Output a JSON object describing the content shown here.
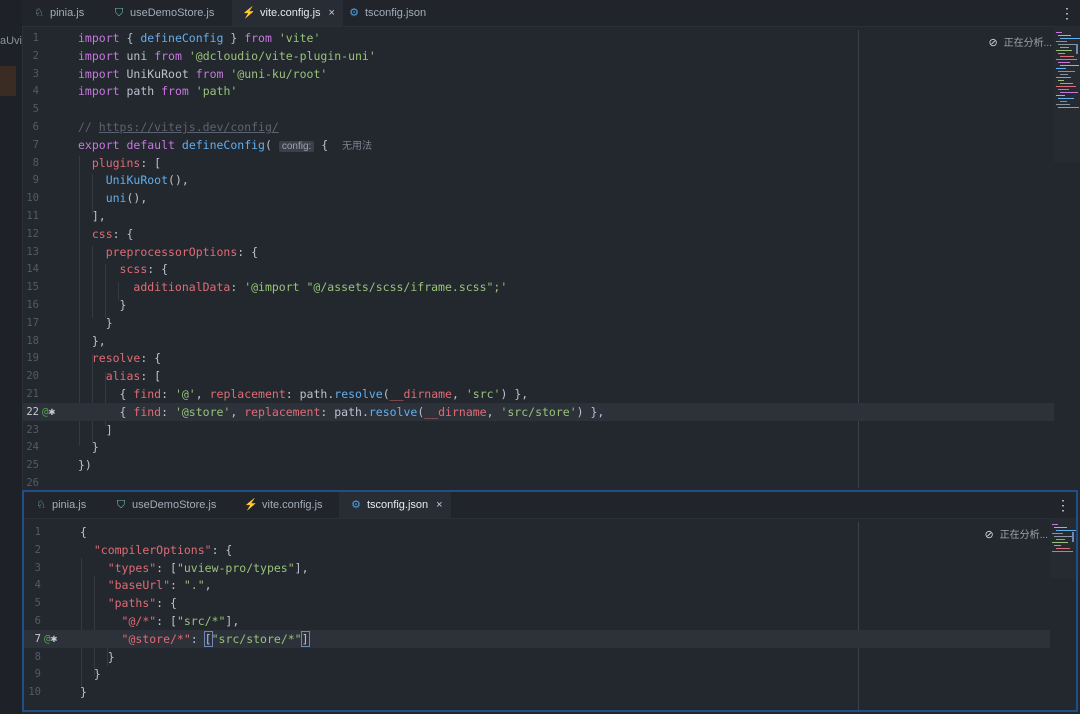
{
  "sidebar": {
    "fragment": "aUvi"
  },
  "top_editor": {
    "tabs": [
      {
        "label": "pinia.js",
        "icon": "pinia-icon",
        "active": false
      },
      {
        "label": "useDemoStore.js",
        "icon": "vue-icon",
        "active": false
      },
      {
        "label": "vite.config.js",
        "icon": "vite-icon",
        "active": true,
        "close": "×"
      },
      {
        "label": "tsconfig.json",
        "icon": "tsconfig-icon",
        "active": false
      }
    ],
    "menu": "⋮",
    "status": "正在分析...",
    "lines": [
      {
        "n": "1",
        "html": "<span class=\"k\">import</span> { <span class=\"f\">defineConfig</span> } <span class=\"k\">from</span> <span class=\"s\">'vite'</span>"
      },
      {
        "n": "2",
        "html": "<span class=\"k\">import</span> <span class=\"d\">uni</span> <span class=\"k\">from</span> <span class=\"s\">'@dcloudio/vite-plugin-uni'</span>"
      },
      {
        "n": "3",
        "html": "<span class=\"k\">import</span> <span class=\"d\">UniKuRoot</span> <span class=\"k\">from</span> <span class=\"s\">'@uni-ku/root'</span>"
      },
      {
        "n": "4",
        "html": "<span class=\"k\">import</span> <span class=\"d\">path</span> <span class=\"k\">from</span> <span class=\"s\">'path'</span>"
      },
      {
        "n": "5",
        "html": ""
      },
      {
        "n": "6",
        "html": "<span class=\"c\">// </span><span class=\"u\">https://vitejs.dev/config/</span>"
      },
      {
        "n": "7",
        "html": "<span class=\"k\">export</span> <span class=\"k\">default</span> <span class=\"f\">defineConfig</span>( <span class=\"hint\">config:</span> {  <span class=\"ghost\">无用法</span>"
      },
      {
        "n": "8",
        "html": "  <span class=\"p\">plugins</span>: ["
      },
      {
        "n": "9",
        "html": "    <span class=\"f\">UniKuRoot</span>(),"
      },
      {
        "n": "10",
        "html": "    <span class=\"f\">uni</span>(),"
      },
      {
        "n": "11",
        "html": "  ],"
      },
      {
        "n": "12",
        "html": "  <span class=\"p\">css</span>: {"
      },
      {
        "n": "13",
        "html": "    <span class=\"p\">preprocessorOptions</span>: {"
      },
      {
        "n": "14",
        "html": "      <span class=\"p\">scss</span>: {"
      },
      {
        "n": "15",
        "html": "        <span class=\"p\">additionalData</span>: <span class=\"s\">'@import \"@/assets/scss/iframe.scss\";'</span>"
      },
      {
        "n": "16",
        "html": "      }"
      },
      {
        "n": "17",
        "html": "    }"
      },
      {
        "n": "18",
        "html": "  },"
      },
      {
        "n": "19",
        "html": "  <span class=\"p\">resolve</span>: {"
      },
      {
        "n": "20",
        "html": "    <span class=\"p\">alias</span>: ["
      },
      {
        "n": "21",
        "html": "      { <span class=\"p\">find</span>: <span class=\"s\">'@'</span>, <span class=\"p\">replacement</span>: <span class=\"d\">path</span>.<span class=\"f\">resolve</span>(<span class=\"p\">__dirname</span>, <span class=\"s\">'src'</span>) },"
      },
      {
        "n": "22",
        "html": "      { <span class=\"p\">find</span>: <span class=\"s\">'@store'</span>, <span class=\"p\">replacement</span>: <span class=\"d\">path</span>.<span class=\"f\">resolve</span>(<span class=\"p\">__dirname</span>, <span class=\"s\">'src/store'</span>) },",
        "current": true,
        "gutter": "✱"
      },
      {
        "n": "23",
        "html": "    ]"
      },
      {
        "n": "24",
        "html": "  }"
      },
      {
        "n": "25",
        "html": "})"
      },
      {
        "n": "26",
        "html": ""
      }
    ]
  },
  "bottom_editor": {
    "tabs": [
      {
        "label": "pinia.js",
        "icon": "pinia-icon",
        "active": false
      },
      {
        "label": "useDemoStore.js",
        "icon": "vue-icon",
        "active": false
      },
      {
        "label": "vite.config.js",
        "icon": "vite-icon",
        "active": false
      },
      {
        "label": "tsconfig.json",
        "icon": "tsconfig-icon",
        "active": true,
        "close": "×"
      }
    ],
    "menu": "⋮",
    "status": "正在分析...",
    "lines": [
      {
        "n": "1",
        "html": "{"
      },
      {
        "n": "2",
        "html": "  <span class=\"p\">\"compilerOptions\"</span>: {"
      },
      {
        "n": "3",
        "html": "    <span class=\"p\">\"types\"</span>: [<span class=\"s\">\"uview-pro/types\"</span>],"
      },
      {
        "n": "4",
        "html": "    <span class=\"p\">\"baseUrl\"</span>: <span class=\"s\">\".\"</span>,"
      },
      {
        "n": "5",
        "html": "    <span class=\"p\">\"paths\"</span>: {"
      },
      {
        "n": "6",
        "html": "      <span class=\"p\">\"@/*\"</span>: [<span class=\"s\">\"src/*\"</span>],"
      },
      {
        "n": "7",
        "html": "      <span class=\"p\">\"@store/*\"</span>: <span class=\"bm\">[</span><span class=\"s\">\"src/store/*\"</span><span class=\"bm\">]</span>",
        "current": true,
        "gutter": "✱"
      },
      {
        "n": "8",
        "html": "    }"
      },
      {
        "n": "9",
        "html": "  }"
      },
      {
        "n": "10",
        "html": "}"
      }
    ]
  },
  "colors": {
    "background": "#23272e",
    "accent_border": "#1f4f86",
    "keyword": "#c678dd",
    "string": "#98c379",
    "function": "#61afef",
    "property": "#e06c75"
  }
}
